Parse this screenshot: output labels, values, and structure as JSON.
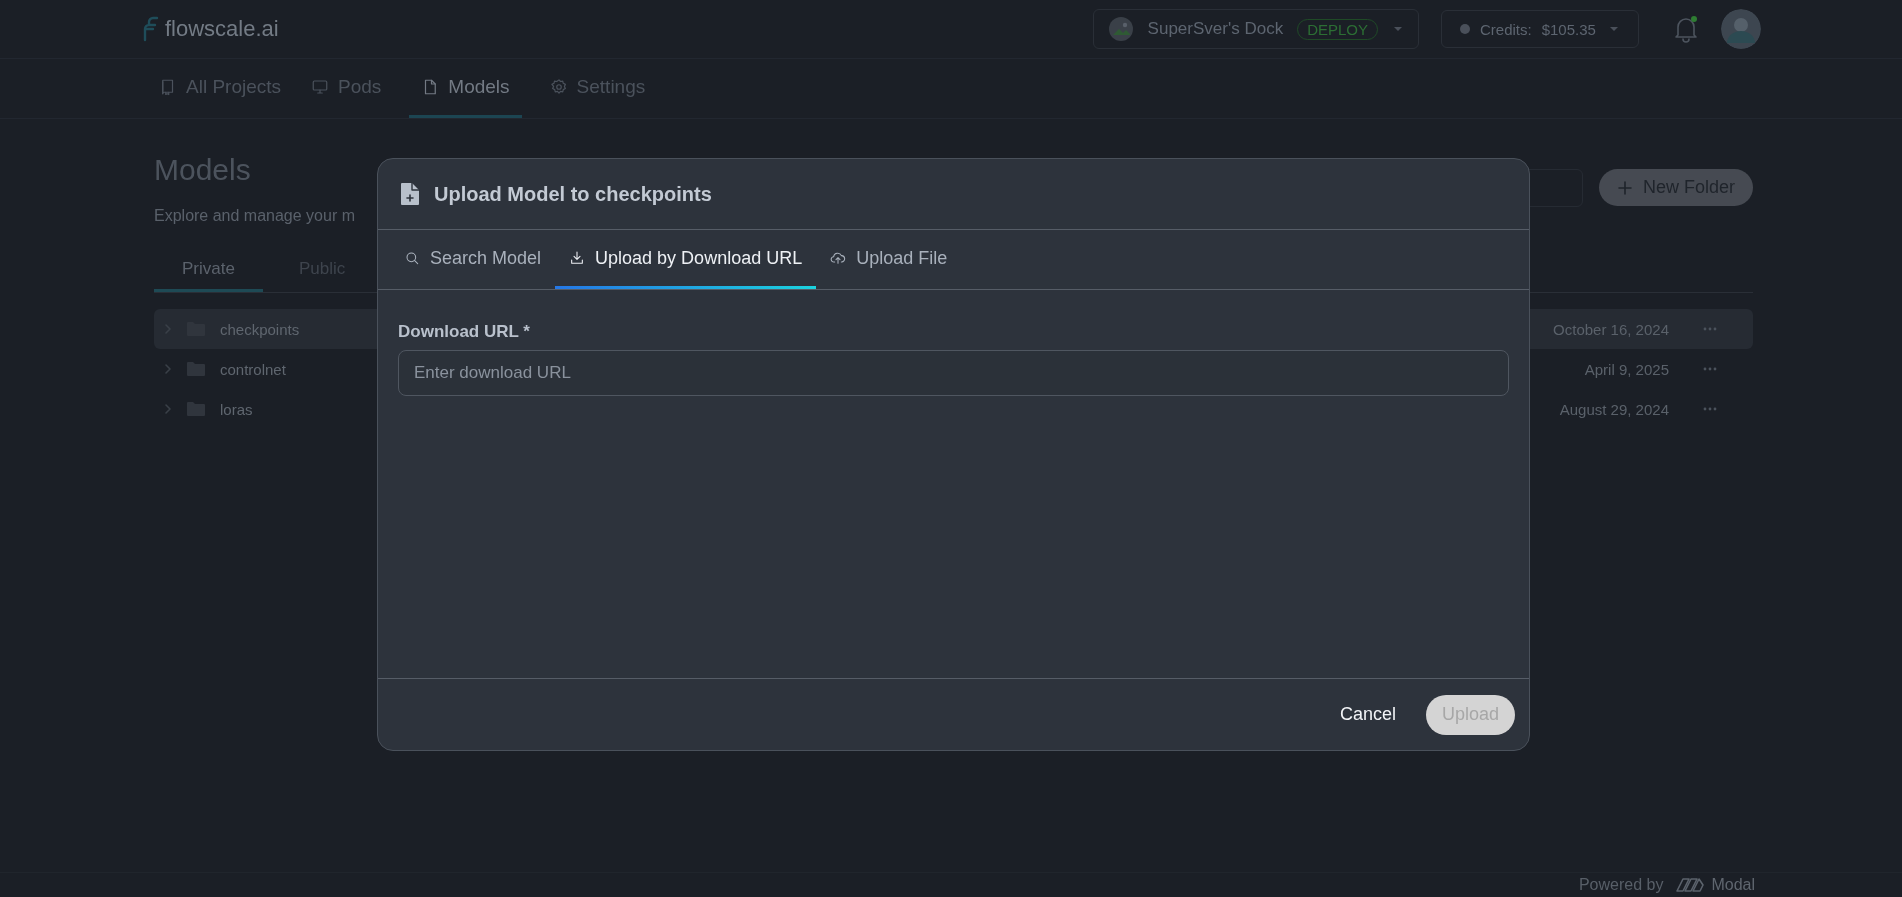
{
  "header": {
    "logo": "flowscale.ai",
    "workspace": {
      "name": "SuperSver's Dock",
      "badge": "DEPLOY"
    },
    "credits": {
      "label": "Credits:",
      "amount": "$105.35"
    },
    "notifications": {
      "unread": true
    }
  },
  "nav": [
    {
      "label": "All Projects",
      "kind": "book",
      "selected": false
    },
    {
      "label": "Pods",
      "kind": "monitor",
      "selected": false
    },
    {
      "label": "Models",
      "kind": "file",
      "selected": true
    },
    {
      "label": "Settings",
      "kind": "gear",
      "selected": false
    }
  ],
  "page": {
    "title": "Models",
    "subtitle": "Explore and manage your m",
    "new_folder": "New Folder",
    "tabs": [
      {
        "label": "Private",
        "selected": true
      },
      {
        "label": "Public",
        "selected": false
      }
    ],
    "folders": [
      {
        "name": "checkpoints",
        "date": "October 16, 2024",
        "selected": true
      },
      {
        "name": "controlnet",
        "date": "April 9, 2025",
        "selected": false
      },
      {
        "name": "loras",
        "date": "August 29, 2024",
        "selected": false
      }
    ]
  },
  "dialog": {
    "title": "Upload Model to checkpoints",
    "tabs": [
      {
        "label": "Search Model",
        "kind": "search",
        "selected": false
      },
      {
        "label": "Upload by Download URL",
        "kind": "download",
        "selected": true
      },
      {
        "label": "Upload File",
        "kind": "cloud",
        "selected": false
      }
    ],
    "field": {
      "label": "Download URL *",
      "placeholder": "Enter download URL"
    },
    "buttons": [
      {
        "label": "Cancel",
        "kind": "text",
        "disabled": false
      },
      {
        "label": "Upload",
        "kind": "primary",
        "disabled": true
      }
    ]
  },
  "footer": {
    "powered_by": "Powered by",
    "brand": "Modal"
  }
}
